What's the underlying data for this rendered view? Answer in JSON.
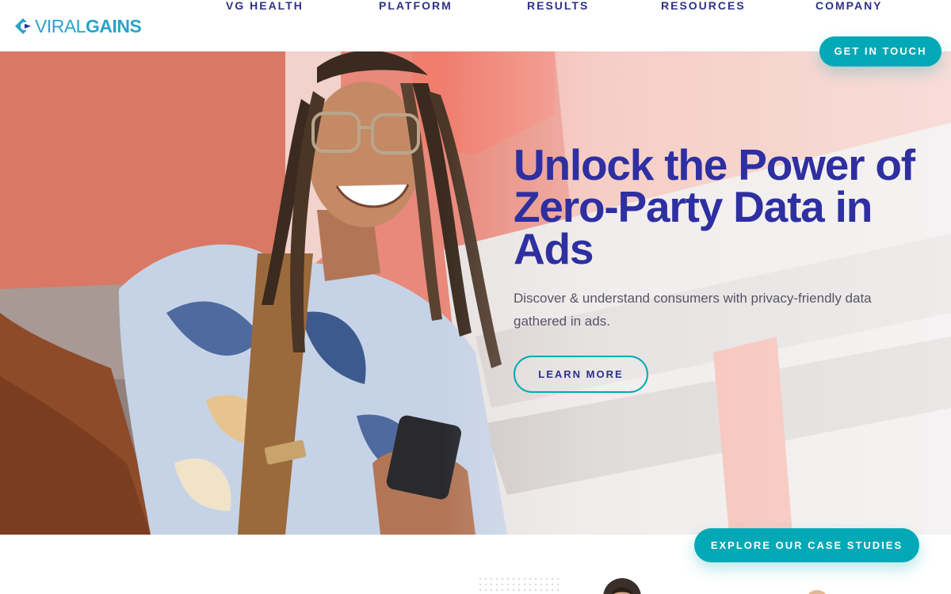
{
  "header": {
    "logo": {
      "viral": "VIRAL",
      "gains": "GAINS",
      "icon": "viralgains-diamond-logo"
    },
    "nav": [
      {
        "label": "VG HEALTH"
      },
      {
        "label": "PLATFORM"
      },
      {
        "label": "RESULTS"
      },
      {
        "label": "RESOURCES"
      },
      {
        "label": "COMPANY"
      }
    ],
    "cta_label": "GET IN TOUCH"
  },
  "hero": {
    "title": "Unlock the Power of Zero-Party Data in Ads",
    "subtitle": "Discover & understand consumers with privacy-friendly data gathered in ads.",
    "button_label": "LEARN MORE",
    "image": "man-with-dreadlocks-smiling-holding-phone"
  },
  "case_studies": {
    "button_label": "EXPLORE OUR CASE STUDIES"
  },
  "colors": {
    "brand_blue": "#2e2fa0",
    "nav_text": "#2c3187",
    "teal": "#00a9b5",
    "logo_cyan": "#2aa3c9",
    "body_text": "#555566"
  }
}
